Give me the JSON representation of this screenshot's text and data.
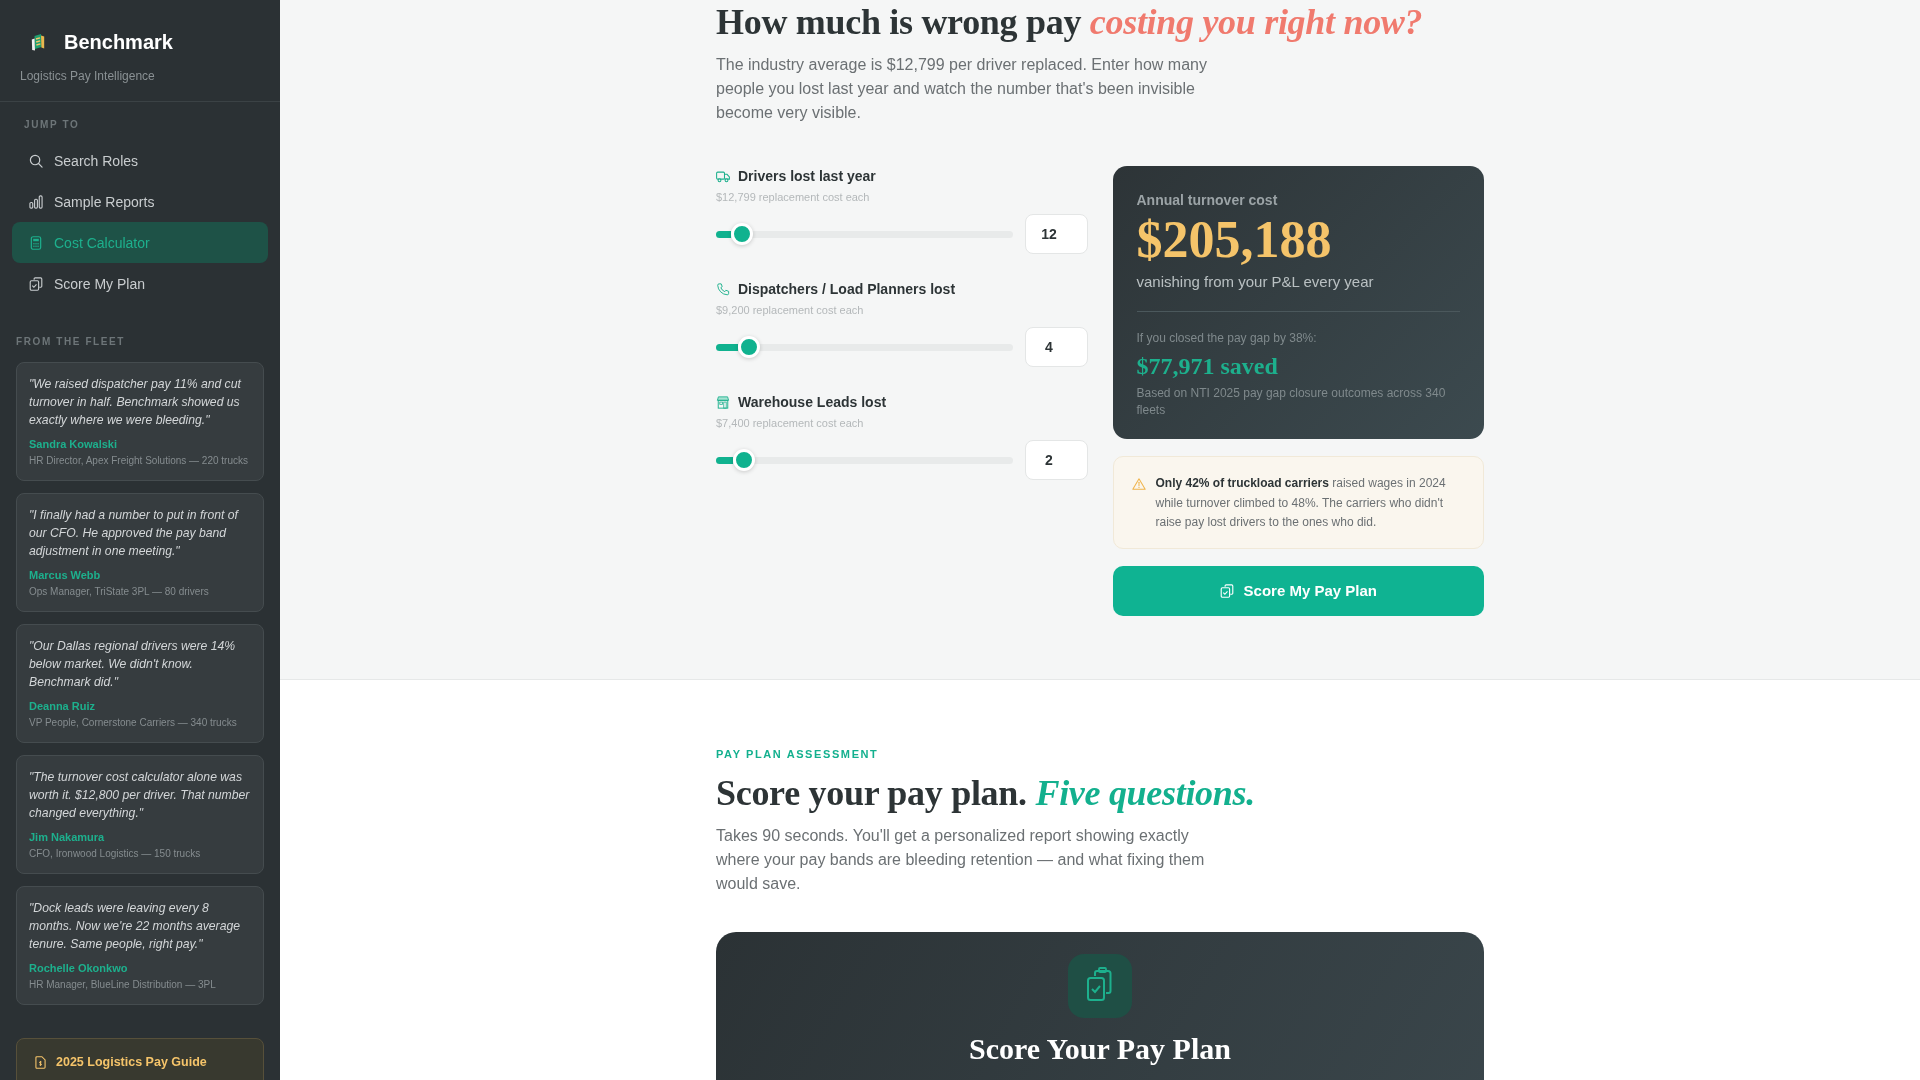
{
  "sidebar": {
    "brand": {
      "name": "Benchmark",
      "tagline": "Logistics Pay Intelligence"
    },
    "nav_heading": "JUMP TO",
    "nav_items": [
      {
        "label": "Search Roles",
        "selected": false
      },
      {
        "label": "Sample Reports",
        "selected": false
      },
      {
        "label": "Cost Calculator",
        "selected": true
      },
      {
        "label": "Score My Plan",
        "selected": false
      }
    ],
    "testimonials_heading": "FROM THE FLEET",
    "testimonials": [
      {
        "quote": "\"We raised dispatcher pay 11% and cut turnover in half. Benchmark showed us exactly where we were bleeding.\"",
        "name": "Sandra Kowalski",
        "role": "HR Director, Apex Freight Solutions — 220 trucks"
      },
      {
        "quote": "\"I finally had a number to put in front of our CFO. He approved the pay band adjustment in one meeting.\"",
        "name": "Marcus Webb",
        "role": "Ops Manager, TriState 3PL — 80 drivers"
      },
      {
        "quote": "\"Our Dallas regional drivers were 14% below market. We didn't know. Benchmark did.\"",
        "name": "Deanna Ruiz",
        "role": "VP People, Cornerstone Carriers — 340 trucks"
      },
      {
        "quote": "\"The turnover cost calculator alone was worth it. $12,800 per driver. That number changed everything.\"",
        "name": "Jim Nakamura",
        "role": "CFO, Ironwood Logistics — 150 trucks"
      },
      {
        "quote": "\"Dock leads were leaving every 8 months. Now we're 22 months average tenure. Same people, right pay.\"",
        "name": "Rochelle Okonkwo",
        "role": "HR Manager, BlueLine Distribution — 3PL"
      }
    ],
    "guide_link": "2025 Logistics Pay Guide"
  },
  "calculator": {
    "title": "How much is wrong pay *costing you right now?*",
    "intro": "The industry average is $12,799 per driver replaced. Enter how many people you lost last year and watch the number that's been invisible become very visible.",
    "roles": [
      {
        "label": "Drivers lost last year",
        "cost": "$12,799 replacement cost each",
        "level": 0.088,
        "value": "12"
      },
      {
        "label": "Dispatchers / Load Planners lost",
        "cost": "$9,200 replacement cost each",
        "level": 0.111,
        "value": "4"
      },
      {
        "label": "Warehouse Leads lost",
        "cost": "$7,400 replacement cost each",
        "level": 0.095,
        "value": "2"
      }
    ],
    "result": {
      "label": "Annual turnover cost",
      "amount": "$205,188",
      "caption": "vanishing from your P&L every year",
      "savings_label": "If you closed the pay gap by 38%:",
      "savings": "$77,971 saved",
      "footnote": "Based on NTI 2025 pay gap closure outcomes across 340 fleets"
    },
    "notice": "**Only 42% of truckload carriers** raised wages in 2024 while turnover climbed to 48%. The carriers who didn't raise pay lost drivers to the ones who did.",
    "button": "Score My Pay Plan"
  },
  "assessment": {
    "eyebrow": "PAY PLAN ASSESSMENT",
    "title": "Score your pay plan. *Five questions.*",
    "intro": "Takes 90 seconds. You'll get a personalized report showing exactly where your pay bands are bleeding retention — and what fixing them would save.",
    "card_title": "Score Your Pay Plan"
  }
}
